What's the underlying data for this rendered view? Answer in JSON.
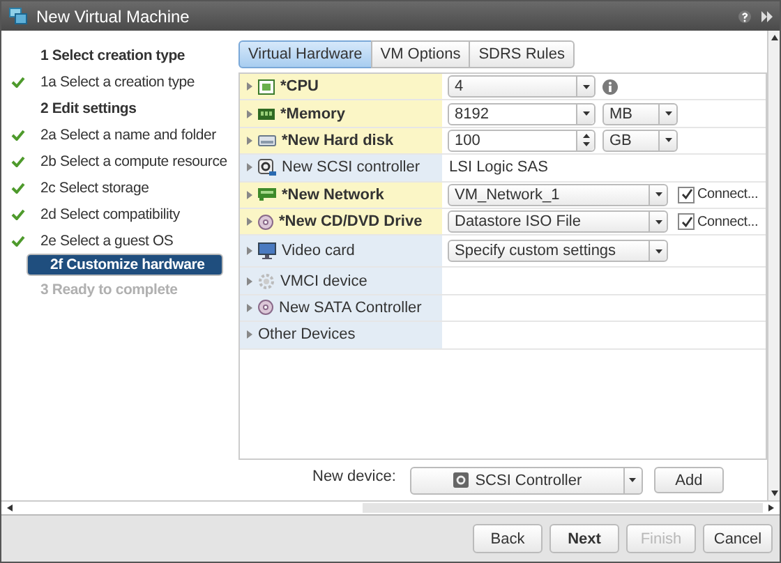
{
  "window": {
    "title": "New Virtual Machine"
  },
  "steps": [
    {
      "kind": "section",
      "label": "1  Select creation type",
      "done": false,
      "selected": false,
      "disabled": false
    },
    {
      "kind": "step",
      "label": "1a  Select a creation type",
      "done": true,
      "selected": false,
      "disabled": false
    },
    {
      "kind": "section",
      "label": "2  Edit settings",
      "done": false,
      "selected": false,
      "disabled": false
    },
    {
      "kind": "step",
      "label": "2a  Select a name and folder",
      "done": true,
      "selected": false,
      "disabled": false
    },
    {
      "kind": "step",
      "label": "2b  Select a compute resource",
      "done": true,
      "selected": false,
      "disabled": false
    },
    {
      "kind": "step",
      "label": "2c  Select storage",
      "done": true,
      "selected": false,
      "disabled": false
    },
    {
      "kind": "step",
      "label": "2d  Select compatibility",
      "done": true,
      "selected": false,
      "disabled": false
    },
    {
      "kind": "step",
      "label": "2e  Select a guest OS",
      "done": true,
      "selected": false,
      "disabled": false
    },
    {
      "kind": "step",
      "label": "2f Customize hardware",
      "done": false,
      "selected": true,
      "disabled": false
    },
    {
      "kind": "section",
      "label": "3  Ready to complete",
      "done": false,
      "selected": false,
      "disabled": true
    }
  ],
  "tabs": [
    {
      "label": "Virtual Hardware",
      "selected": true
    },
    {
      "label": "VM Options",
      "selected": false
    },
    {
      "label": "SDRS Rules",
      "selected": false
    }
  ],
  "devices": [
    {
      "kind": "cpu",
      "label": "*CPU",
      "modified": true,
      "value": {
        "kind": "select",
        "text": "4"
      },
      "info": true
    },
    {
      "kind": "memory",
      "label": "*Memory",
      "modified": true,
      "value": {
        "kind": "combo",
        "text": "8192"
      },
      "unit": "MB"
    },
    {
      "kind": "disk",
      "label": "*New Hard disk",
      "modified": true,
      "value": {
        "kind": "spinner",
        "text": "100"
      },
      "unit": "GB"
    },
    {
      "kind": "scsi",
      "label": "New SCSI controller",
      "modified": false,
      "value": {
        "kind": "text",
        "text": "LSI Logic SAS"
      }
    },
    {
      "kind": "network",
      "label": "*New Network",
      "modified": true,
      "value": {
        "kind": "wide-select",
        "text": "VM_Network_1"
      },
      "connect": {
        "label": "Connect...",
        "checked": true
      }
    },
    {
      "kind": "cdrom",
      "label": "*New CD/DVD Drive",
      "modified": true,
      "value": {
        "kind": "wide-select",
        "text": "Datastore ISO File"
      },
      "connect": {
        "label": "Connect...",
        "checked": true
      }
    },
    {
      "kind": "video",
      "label": "Video card",
      "modified": false,
      "value": {
        "kind": "wide-select",
        "text": "Specify custom settings"
      }
    },
    {
      "kind": "vmci",
      "label": "VMCI device",
      "modified": false
    },
    {
      "kind": "sata",
      "label": "New SATA Controller",
      "modified": false
    },
    {
      "kind": "group",
      "label": "Other Devices",
      "modified": false
    }
  ],
  "new_device": {
    "label": "New device:",
    "value": "SCSI Controller",
    "action": "Add"
  },
  "buttons": [
    {
      "label": "Back",
      "primary": false,
      "disabled": false
    },
    {
      "label": "Next",
      "primary": true,
      "disabled": false
    },
    {
      "label": "Finish",
      "primary": false,
      "disabled": true
    },
    {
      "label": "Cancel",
      "primary": false,
      "disabled": false
    }
  ]
}
